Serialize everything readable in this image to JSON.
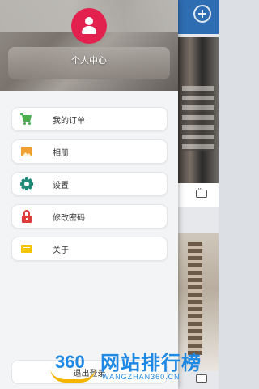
{
  "header": {
    "profile_label": "个人中心"
  },
  "menu": {
    "items": [
      {
        "label": "我的订单",
        "icon": "cart-icon"
      },
      {
        "label": "相册",
        "icon": "album-icon"
      },
      {
        "label": "设置",
        "icon": "gear-icon"
      },
      {
        "label": "修改密码",
        "icon": "lock-icon"
      },
      {
        "label": "关于",
        "icon": "note-icon"
      }
    ]
  },
  "logout": {
    "label": "退出登录"
  },
  "watermark": {
    "brand_num": "360",
    "brand_cn": "网站排行榜",
    "url": "WANGZHAN360.CN"
  },
  "colors": {
    "avatar": "#e2214f",
    "topbar": "#2f6db3",
    "watermark": "#1e88e5"
  }
}
